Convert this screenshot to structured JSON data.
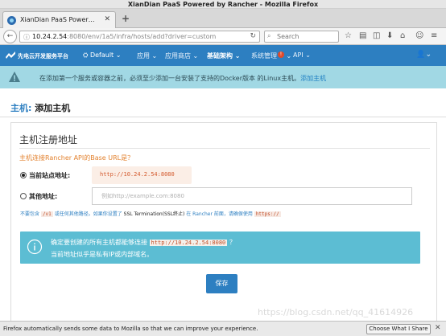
{
  "window": {
    "title": "XianDian PaaS Powered by Rancher - Mozilla Firefox"
  },
  "tab": {
    "title": "XianDian PaaS Power…",
    "close": "✕",
    "new_tab": "+"
  },
  "navbar": {
    "url_host": "10.24.2.54",
    "url_path": ":8080/env/1a5/infra/hosts/add?driver=custom",
    "search_placeholder": "Search"
  },
  "header": {
    "brand": "先电云开发服务平台",
    "environment": "Default",
    "nav": [
      {
        "label": "应用"
      },
      {
        "label": "应用商店"
      },
      {
        "label": "基础架构"
      },
      {
        "label": "系统管理"
      },
      {
        "label": "API"
      }
    ],
    "system_badge": "!"
  },
  "warning": {
    "text": "在添加第一个服务或容器之前，必须至少添加一台安装了支持的Docker版本 的Linux主机。",
    "link": "添加主机"
  },
  "page": {
    "title_prefix": "主机:",
    "title": "添加主机"
  },
  "form": {
    "heading": "主机注册地址",
    "question": "主机连接Rancher API的Base URL是？",
    "current_label": "当前站点地址:",
    "current_value": "http://10.24.2.54:8080",
    "other_label": "其他地址:",
    "other_placeholder": "例如http://example.com:8080",
    "help": {
      "part1": "不要包含",
      "code1": "/v1",
      "part2": "或任何其他路径。如果你设置了",
      "ssl": "SSL Termination(SSL终止)",
      "part3": "在 Rancher 前面，请确保使用",
      "code2": "https://"
    },
    "confirm": {
      "line1_pre": "确定要创建的所有主机都能够连接",
      "line1_code": "http://10.24.2.54:8080",
      "line1_post": "？",
      "line2": "当前地址似乎是私有IP或内部域名。"
    },
    "save": "保存"
  },
  "watermark": "https://blog.csdn.net/qq_41614926",
  "notification": {
    "text": "Firefox automatically sends some data to Mozilla so that we can improve your experience.",
    "button": "Choose What I Share",
    "close": "✕"
  }
}
